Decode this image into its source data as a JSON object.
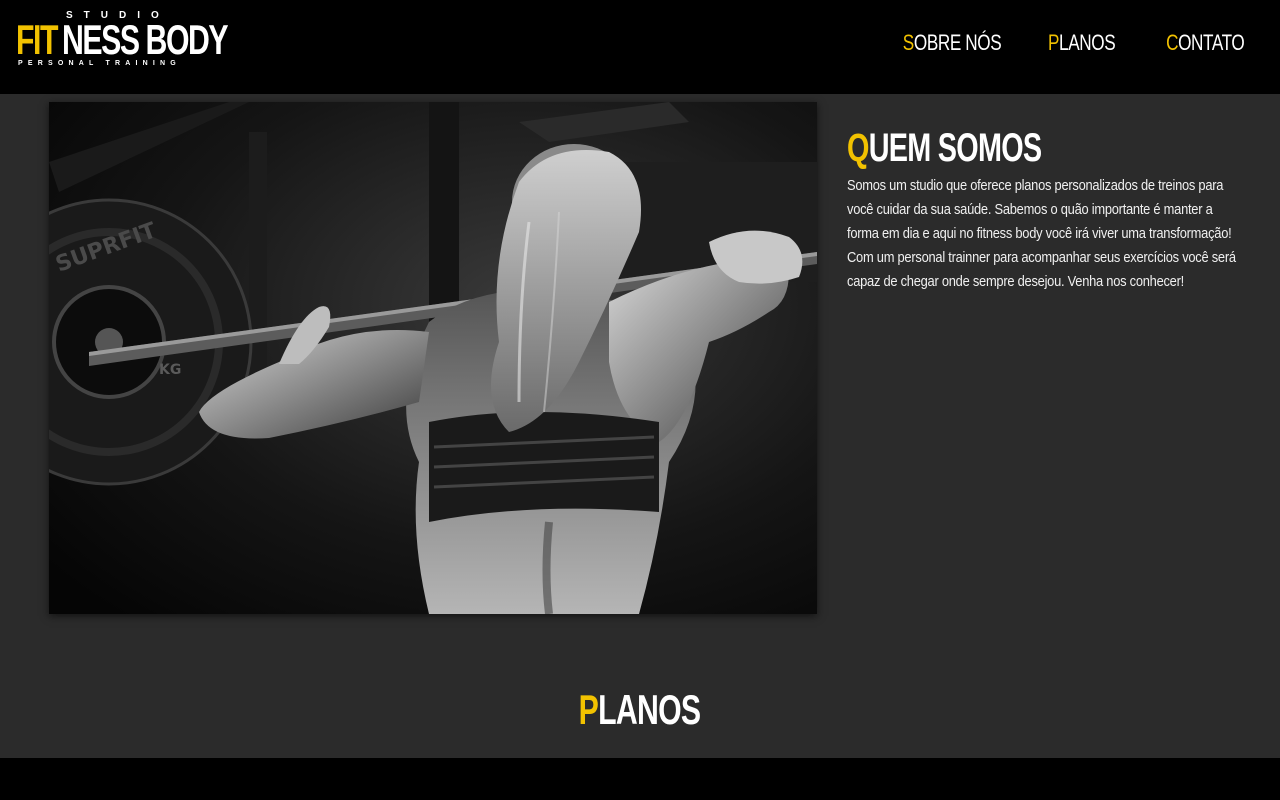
{
  "logo": {
    "studio": "STUDIO",
    "fit": "FIT",
    "ness": "NESS BODY",
    "tagline": "PERSONAL TRAINING"
  },
  "nav": [
    {
      "first": "S",
      "rest": "OBRE NÓS"
    },
    {
      "first": "P",
      "rest": "LANOS"
    },
    {
      "first": "C",
      "rest": "ONTATO"
    }
  ],
  "about": {
    "title_first": "Q",
    "title_rest": "UEM SOMOS",
    "text": "Somos um studio que oferece planos personalizados de treinos para você cuidar da sua saúde. Sabemos o quão importante é manter a forma em dia e aqui no fitness body você irá viver uma transformação! Com um personal trainner para acompanhar seus exercícios você será capaz de chegar onde sempre desejou. Venha nos conhecer!"
  },
  "planos": {
    "title_first": "P",
    "title_rest": "LANOS"
  },
  "colors": {
    "accent": "#f2c200",
    "header_bg": "#000000",
    "main_bg": "#2b2b2b"
  }
}
